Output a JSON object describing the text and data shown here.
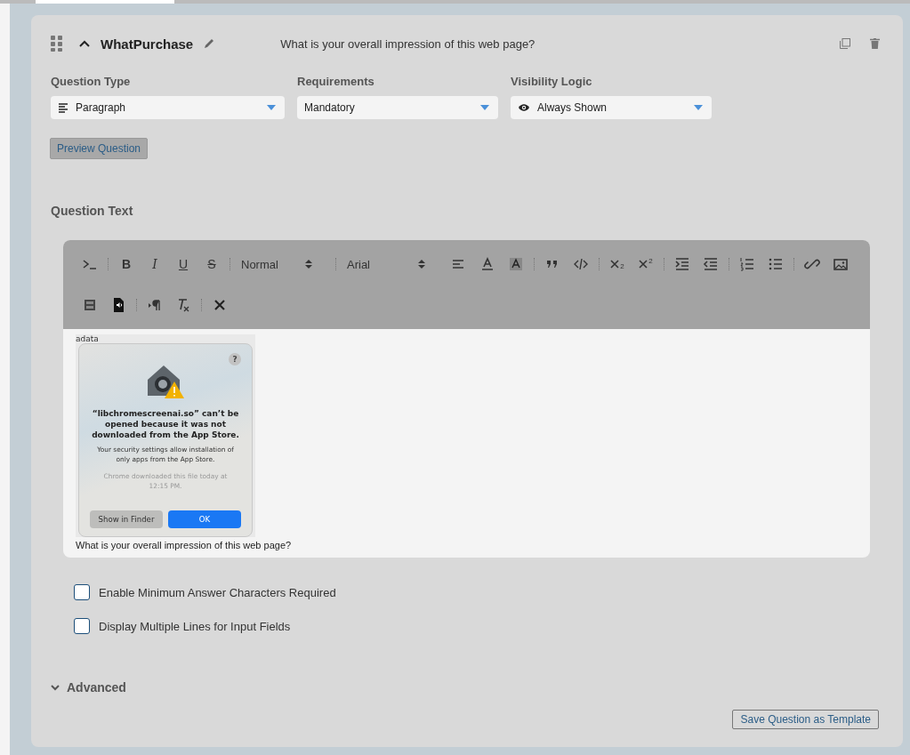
{
  "card": {
    "title": "WhatPurchase",
    "question_preview": "What is your overall impression of this web page?",
    "expanded": true
  },
  "fields": [
    {
      "label": "Question Type",
      "value": "Paragraph"
    },
    {
      "label": "Requirements",
      "value": "Mandatory"
    },
    {
      "label": "Visibility Logic",
      "value": "Always Shown"
    }
  ],
  "preview_button": "Preview Question",
  "question_text_label": "Question Text",
  "toolbar": {
    "bold": "B",
    "italic": "I",
    "underline": "U",
    "strikethrough": "S",
    "header_select": "Normal",
    "font_select": "Arial",
    "subscript_mark": "2",
    "superscript_mark": "2"
  },
  "editor": {
    "screenshot": {
      "background_text": "adata",
      "help": "?",
      "title": "“libchromescreenai.so” can’t be opened because it was not downloaded from the App Store.",
      "body": "Your security settings allow installation of only apps from the App Store.",
      "note": "Chrome downloaded this file today at 12:15 PM.",
      "buttons": [
        "Show in Finder",
        "OK"
      ]
    },
    "text": "What is your overall impression of this web page?"
  },
  "options": [
    {
      "label": "Enable Minimum Answer Characters Required",
      "checked": false
    },
    {
      "label": "Display Multiple Lines for Input Fields",
      "checked": false
    }
  ],
  "advanced": {
    "label": "Advanced",
    "expanded": false
  },
  "template_button": "Save Question as Template"
}
